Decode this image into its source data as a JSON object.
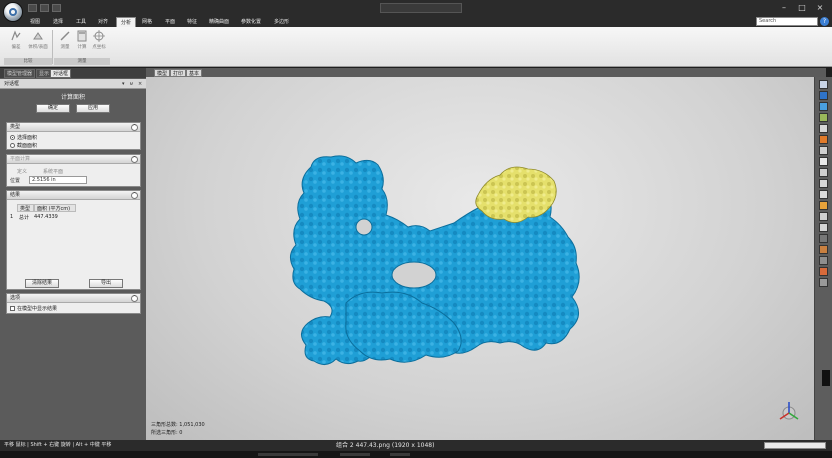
{
  "titlebar": {
    "window_title": "",
    "controls": [
      "–",
      "□",
      "×"
    ]
  },
  "ribbon": {
    "tabs": [
      "视图",
      "选择",
      "工具",
      "对齐",
      "分析",
      "网格",
      "平面",
      "特征",
      "精确曲面",
      "参数化置",
      "多边形"
    ],
    "active_tab_index": 4,
    "search_placeholder": "Search",
    "help_label": "?",
    "buttons": [
      {
        "label": "偏差",
        "icon": "deviation-icon"
      },
      {
        "label": "体积/表面",
        "icon": "volume-icon"
      },
      {
        "label": "测量",
        "icon": "measure-icon"
      },
      {
        "label": "计算",
        "icon": "calculator-icon"
      },
      {
        "label": "点坐标",
        "icon": "target-icon"
      }
    ],
    "groups": [
      "比较",
      "测量"
    ]
  },
  "left_panel": {
    "tabs": [
      "模型管理器",
      "显示",
      "对话框"
    ],
    "active_tab_index": 2,
    "panel_title": "对话框",
    "panel_controls": [
      "▾",
      "ᵾ",
      "×"
    ],
    "calc_title": "计算面积",
    "ok_label": "确定",
    "apply_label": "应用",
    "type_section": {
      "title": "类型",
      "options": [
        "选择面积",
        "截面面积"
      ],
      "selected_index": 0
    },
    "plane_section": {
      "title": "平面计算",
      "define_label": "定义",
      "define_value": "系统平面",
      "position_label": "位置",
      "position_value": "2.5156 in"
    },
    "result_section": {
      "title": "结果",
      "columns": [
        "类型",
        "面积 (平方cm)"
      ],
      "rows": [
        {
          "index": "1",
          "type": "总计",
          "area": "447.4339"
        }
      ],
      "clear_label": "清除结果",
      "export_label": "导出"
    },
    "options_section": {
      "title": "选项",
      "checkbox_label": "在模型中显示结果"
    }
  },
  "viewport": {
    "tabs": [
      "模型",
      "打印",
      "基本"
    ],
    "triangle_count": "三角形总数: 1,051,030",
    "selected_count": "所选三角形: 0",
    "mesh_color": "#1a9ed6",
    "selection_color": "#e4e06a"
  },
  "statusbar": {
    "left_text": "平移 鼠标 | Shift + 右键 旋转 | Alt + 中键 平移",
    "center_text": "组合 2 447.43.png (1920 x 1048)"
  },
  "right_toolbar": {
    "tools": [
      {
        "icon": "view-front-icon",
        "color": "#c9d4e6"
      },
      {
        "icon": "view-iso-icon",
        "color": "#2f73c9"
      },
      {
        "icon": "view-top-icon",
        "color": "#4aa0e0"
      },
      {
        "icon": "render-mode-icon",
        "color": "#9ab85a"
      },
      {
        "icon": "zoom-fit-icon",
        "color": "#d7d7d7"
      },
      {
        "icon": "color-map-icon",
        "color": "#e07a2a"
      },
      {
        "icon": "light-icon",
        "color": "#d0d0d0"
      },
      {
        "icon": "clip-icon",
        "color": "#e9e9e9"
      },
      {
        "icon": "section-icon",
        "color": "#cfcfcf"
      },
      {
        "icon": "grid-icon",
        "color": "#d9d9d9"
      },
      {
        "icon": "axis-icon",
        "color": "#dadada"
      },
      {
        "icon": "paint-icon",
        "color": "#e8a23a"
      },
      {
        "icon": "select-icon",
        "color": "#cfcfcf"
      },
      {
        "icon": "brush-icon",
        "color": "#d5d5d5"
      },
      {
        "icon": "hide-icon",
        "color": "#777777"
      },
      {
        "icon": "wrench-icon",
        "color": "#c98040"
      },
      {
        "icon": "settings-icon",
        "color": "#8f8f8f"
      },
      {
        "icon": "palette-icon",
        "color": "#d86a3a"
      },
      {
        "icon": "more-icon",
        "color": "#9a9a9a"
      }
    ]
  }
}
